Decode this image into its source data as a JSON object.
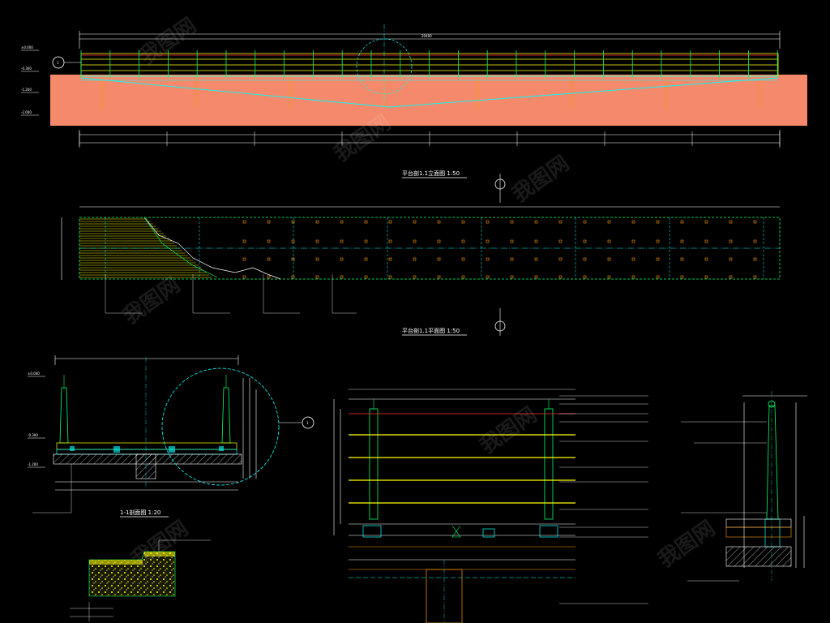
{
  "drawing": {
    "background": "#000000",
    "colors": {
      "line_white": "#ffffff",
      "line_yellow": "#ffff00",
      "line_green": "#00ff66",
      "line_cyan": "#00ffff",
      "line_orange": "#ff9900",
      "water_fill": "#f4896b",
      "rail_red": "#ff3030"
    }
  },
  "views": {
    "elevation": {
      "title": "平台剖1.1立面图 1:50"
    },
    "plan": {
      "title": "平台剖1.1平面图 1:50"
    },
    "section": {
      "title": "1-1剖面图 1:20"
    }
  },
  "markers": {
    "axis_top": "1",
    "axis_mid": "1",
    "detail_ref": "1"
  },
  "elevation_marks": [
    "±0.000",
    "-0.300",
    "-1.200",
    "-2.000"
  ],
  "section_elevation_marks": [
    "±0.000",
    "-0.300",
    "-1.200"
  ],
  "watermark": "我图网"
}
